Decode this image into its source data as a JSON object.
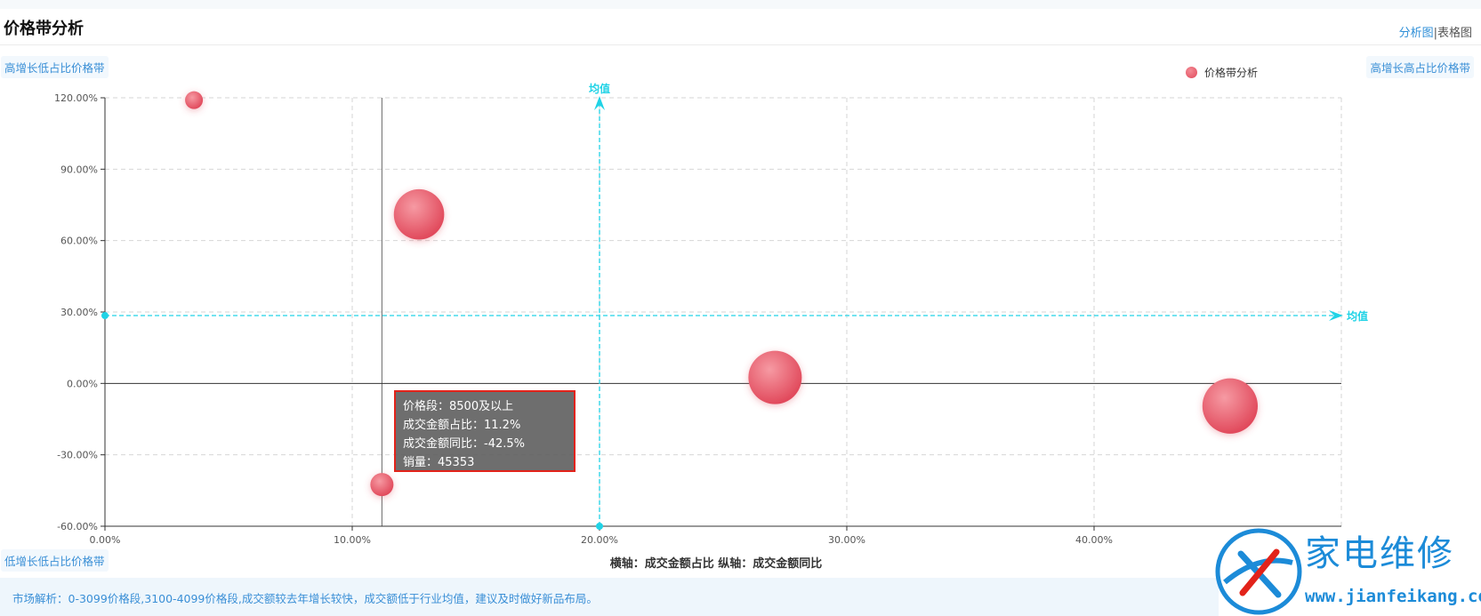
{
  "header": {
    "title": "价格带分析",
    "view_analysis": "分析图",
    "view_separator": "|",
    "view_table": "表格图"
  },
  "quadrants": {
    "top_left": "高增长低占比价格带",
    "top_right": "高增长高占比价格带",
    "bottom_left": "低增长低占比价格带"
  },
  "tooltip": {
    "lines": [
      "价格段：8500及以上",
      "成交金额占比：11.2%",
      "成交金额同比：-42.5%",
      "销量：45353"
    ]
  },
  "footer": {
    "text": "市场解析：0-3099价格段,3100-4099价格段,成交额较去年增长较快，成交额低于行业均值，建议及时做好新品布局。"
  },
  "watermark": {
    "cn": "家电维修",
    "url": "www.jianfeikang.com"
  },
  "chart_data": {
    "type": "scatter",
    "xlabel": "横轴：成交金额占比  纵轴：成交金额同比",
    "xlim": [
      0,
      50
    ],
    "ylim": [
      -60,
      120
    ],
    "x_ticks": [
      "0.00%",
      "10.00%",
      "20.00%",
      "30.00%",
      "40.00%"
    ],
    "x_tick_values": [
      0,
      10,
      20,
      30,
      40
    ],
    "y_ticks": [
      "-60.00%",
      "-30.00%",
      "0.00%",
      "30.00%",
      "60.00%",
      "90.00%",
      "120.00%"
    ],
    "y_tick_values": [
      -60,
      -30,
      0,
      30,
      60,
      90,
      120
    ],
    "grid": true,
    "legend": {
      "position": "top-right",
      "label": "价格带分析"
    },
    "mean_lines": {
      "label": "均值",
      "x": 20,
      "y": 28.5
    },
    "series": [
      {
        "name": "价格带分析",
        "color": "#e8596a",
        "points": [
          {
            "x": 3.6,
            "y": 119,
            "size": 3000
          },
          {
            "x": 12.7,
            "y": 71,
            "size": 25000
          },
          {
            "x": 11.2,
            "y": -42.5,
            "size": 45353
          },
          {
            "x": 27.1,
            "y": 2.5,
            "size": 28000
          },
          {
            "x": 45.5,
            "y": -9.5,
            "size": 30000
          }
        ],
        "radii_hint": "proportional"
      }
    ],
    "highlighted_point_index": 2
  }
}
